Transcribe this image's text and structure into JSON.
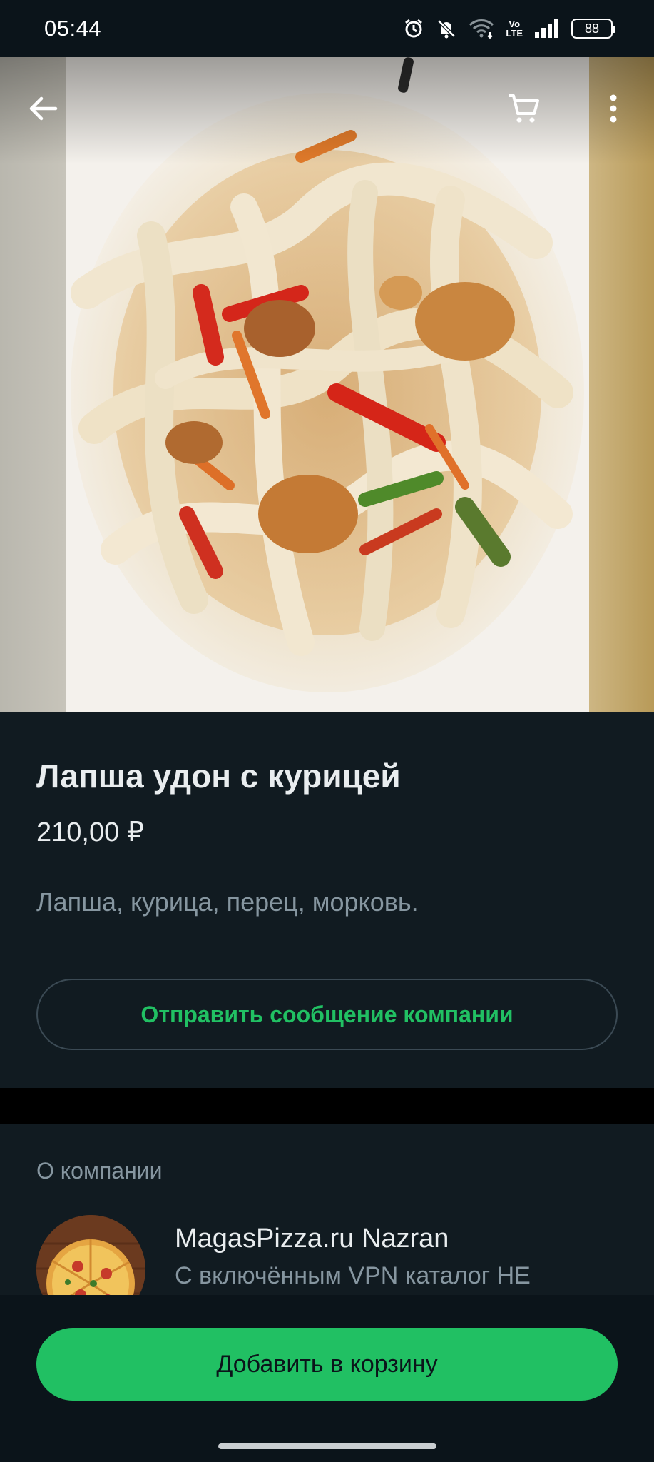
{
  "status_bar": {
    "time": "05:44",
    "battery_level": "88",
    "icons": [
      "alarm-icon",
      "bell-muted-icon",
      "wifi-icon",
      "volte-icon",
      "signal-icon",
      "battery-icon"
    ],
    "lte_top": "Vo",
    "lte_bottom": "LTE"
  },
  "header": {
    "icons": [
      "back-arrow-icon",
      "cart-icon",
      "more-vertical-icon"
    ]
  },
  "product": {
    "title": "Лапша удон с курицей",
    "price": "210,00 ₽",
    "description": "Лапша, курица, перец, морковь.",
    "message_button_label": "Отправить сообщение компании"
  },
  "company": {
    "heading": "О компании",
    "name": "MagasPizza.ru Nazran",
    "subtitle": "С включённым VPN каталог НЕ"
  },
  "bottom_bar": {
    "add_to_cart_label": "Добавить в корзину"
  },
  "colors": {
    "background": "#0b141a",
    "surface": "#111b21",
    "accent_green": "#21c063",
    "text_primary": "#e9edef",
    "text_secondary": "#8696a0"
  }
}
